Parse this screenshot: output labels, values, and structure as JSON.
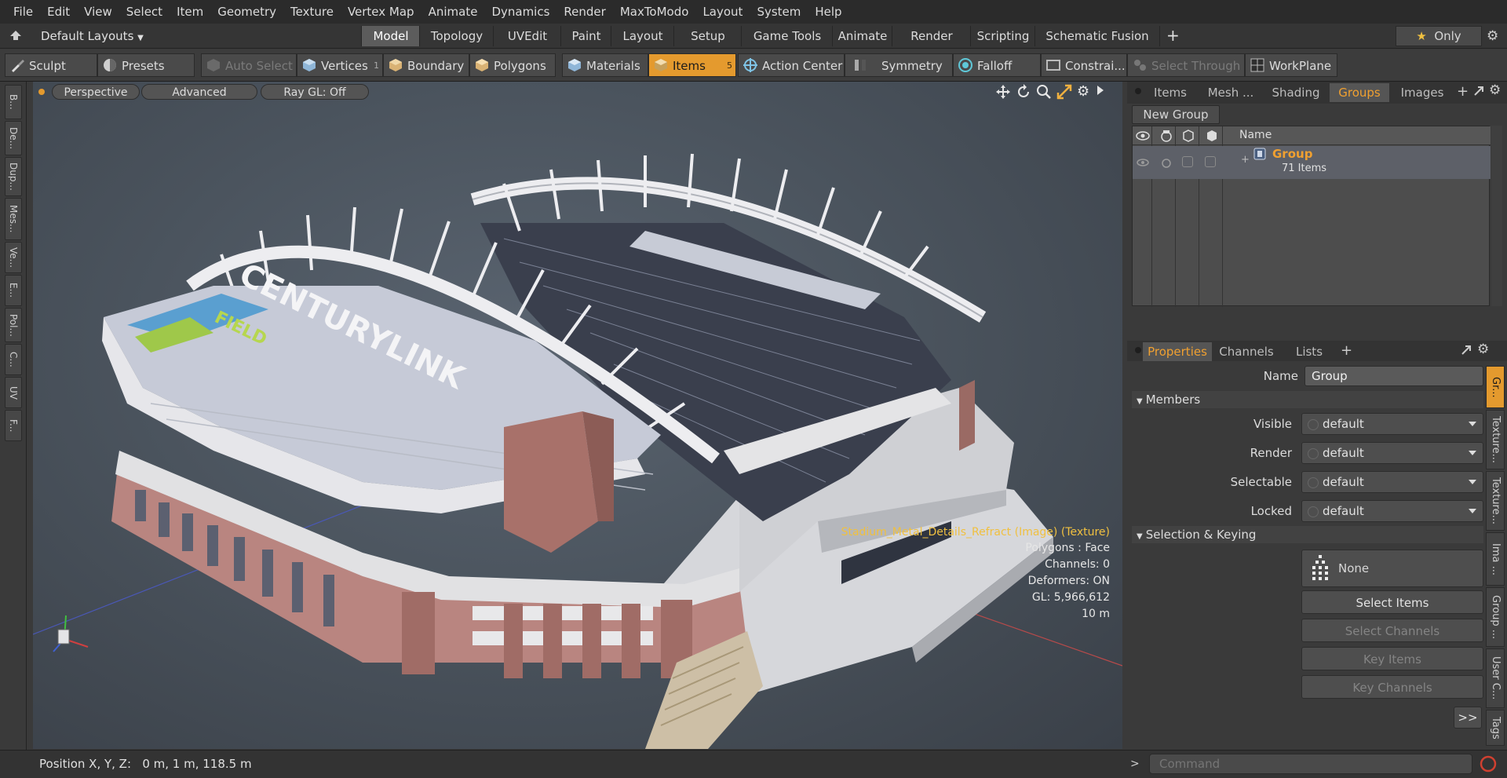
{
  "menu": [
    "File",
    "Edit",
    "View",
    "Select",
    "Item",
    "Geometry",
    "Texture",
    "Vertex Map",
    "Animate",
    "Dynamics",
    "Render",
    "MaxToModo",
    "Layout",
    "System",
    "Help"
  ],
  "layout_selector": "Default Layouts",
  "tabs": [
    "Model",
    "Topology",
    "UVEdit",
    "Paint",
    "Layout",
    "Setup",
    "Game Tools",
    "Animate",
    "Render",
    "Scripting",
    "Schematic Fusion"
  ],
  "active_tab": "Model",
  "only_label": "Only",
  "toolbar": {
    "sculpt": "Sculpt",
    "presets": "Presets",
    "auto_select": "Auto Select",
    "vertices": "Vertices",
    "vertices_count": "1",
    "boundary": "Boundary",
    "polygons": "Polygons",
    "materials": "Materials",
    "items": "Items",
    "items_count": "5",
    "action_center": "Action Center",
    "symmetry": "Symmetry",
    "falloff": "Falloff",
    "constraints": "Constrai...",
    "select_through": "Select Through",
    "workplane": "WorkPlane"
  },
  "left_strip": [
    "B...",
    "De...",
    "Dup...",
    "Mes...",
    "Ve...",
    "E...",
    "Pol...",
    "C...",
    "UV",
    "F..."
  ],
  "viewport": {
    "perspective": "Perspective",
    "advanced": "Advanced",
    "raygl": "Ray GL: Off",
    "info_texture": "Stadium_Metal_Details_Refract (Image) (Texture)",
    "info_polygons": "Polygons : Face",
    "info_channels": "Channels: 0",
    "info_deformers": "Deformers: ON",
    "info_gl": "GL: 5,966,612",
    "info_scale": "10 m",
    "roof_text": "CENTURYLINK",
    "roof_subtext": "FIELD"
  },
  "top_panel": {
    "tabs": [
      "Items",
      "Mesh ...",
      "Shading",
      "Groups",
      "Images"
    ],
    "active": "Groups",
    "new_group": "New Group",
    "name_header": "Name",
    "group_name": "Group",
    "group_count": "71 Items"
  },
  "properties": {
    "tabs": [
      "Properties",
      "Channels",
      "Lists"
    ],
    "active": "Properties",
    "name_label": "Name",
    "name_value": "Group",
    "members_section": "Members",
    "visible_label": "Visible",
    "visible_value": "default",
    "render_label": "Render",
    "render_value": "default",
    "selectable_label": "Selectable",
    "selectable_value": "default",
    "locked_label": "Locked",
    "locked_value": "default",
    "keying_section": "Selection & Keying",
    "none_label": "None",
    "select_items": "Select Items",
    "select_channels": "Select Channels",
    "key_items": "Key Items",
    "key_channels": "Key Channels",
    "more": ">>"
  },
  "side_tabs": [
    "Gr...",
    "Texture...",
    "Texture...",
    "Ima ...",
    "Group ...",
    "User C...",
    "Tags"
  ],
  "status": {
    "position": "Position X, Y, Z:   0 m, 1 m, 118.5 m",
    "command_placeholder": "Command"
  },
  "colors": {
    "accent": "#e49a2e",
    "accent_text": "#f0a030",
    "info_highlight": "#f0c040"
  }
}
